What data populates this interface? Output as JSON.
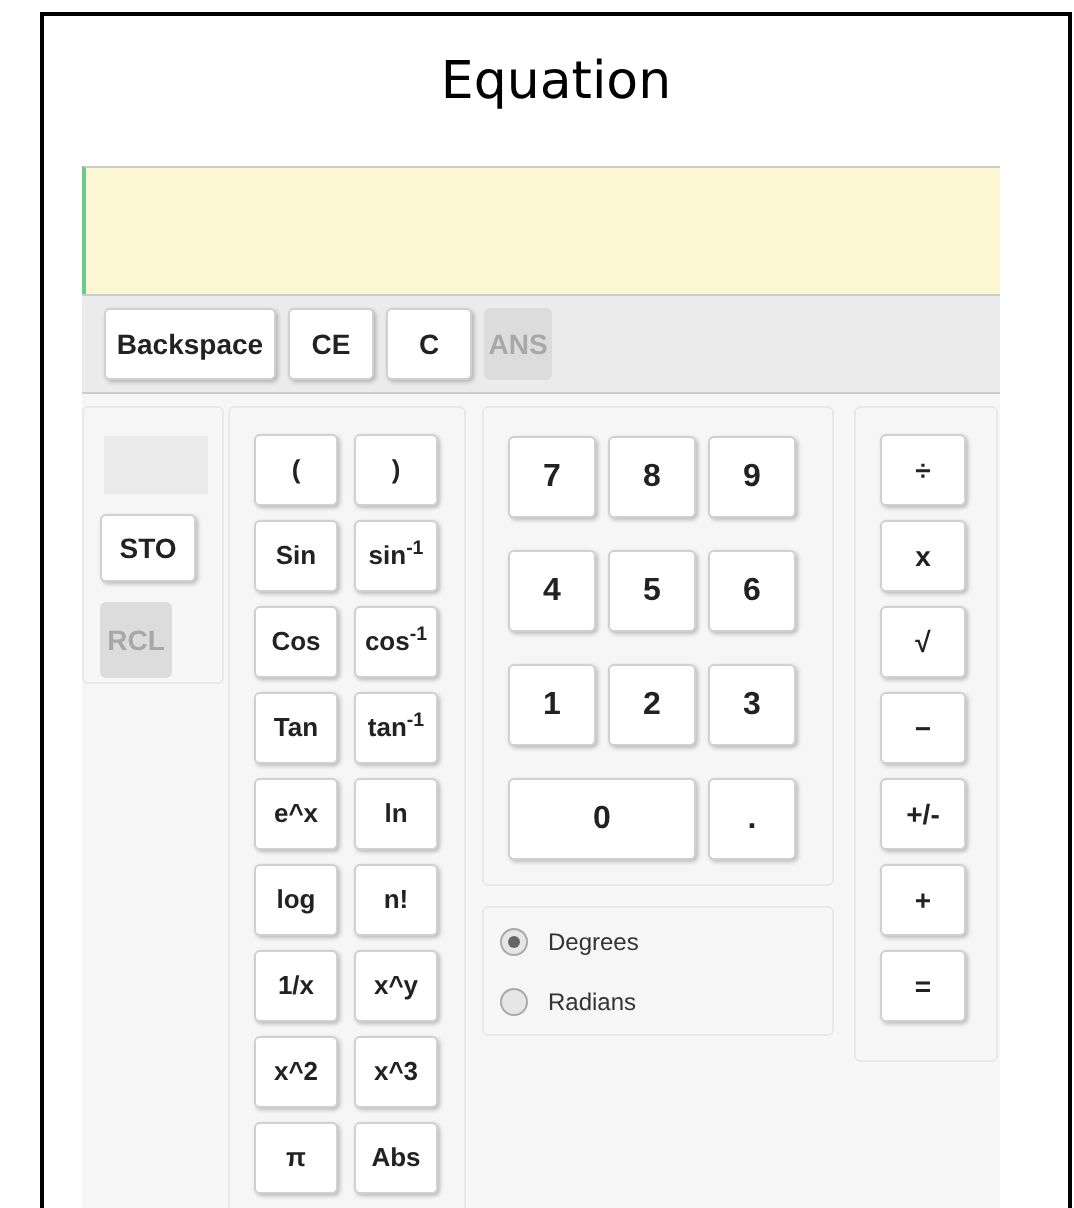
{
  "title": "Equation",
  "toolbar": [
    {
      "label": "Backspace",
      "disabled": false
    },
    {
      "label": "CE",
      "disabled": false
    },
    {
      "label": "C",
      "disabled": false
    },
    {
      "label": "ANS",
      "disabled": true
    }
  ],
  "memory": {
    "buttons": [
      {
        "label": "STO",
        "disabled": false
      },
      {
        "label": "RCL",
        "disabled": true
      }
    ]
  },
  "functions": [
    {
      "label": "("
    },
    {
      "label": ")"
    },
    {
      "label": "Sin"
    },
    {
      "label": "sin$^{-1}$"
    },
    {
      "label": "Cos"
    },
    {
      "label": "cos$^{-1}$"
    },
    {
      "label": "Tan"
    },
    {
      "label": "tan$^{-1}$"
    },
    {
      "label": "e^x"
    },
    {
      "label": "ln"
    },
    {
      "label": "log"
    },
    {
      "label": "n!"
    },
    {
      "label": "1/x"
    },
    {
      "label": "x^y"
    },
    {
      "label": "x^2"
    },
    {
      "label": "x^3"
    },
    {
      "label": "π"
    },
    {
      "label": "Abs"
    }
  ],
  "digits": [
    {
      "label": "7"
    },
    {
      "label": "8"
    },
    {
      "label": "9"
    },
    {
      "label": "4"
    },
    {
      "label": "5"
    },
    {
      "label": "6"
    },
    {
      "label": "1"
    },
    {
      "label": "2"
    },
    {
      "label": "3"
    },
    {
      "label": "0",
      "kind": "wide"
    },
    {
      "label": ".",
      "kind": "normal"
    }
  ],
  "angle": [
    {
      "label": "Degrees",
      "selected": true
    },
    {
      "label": "Radians",
      "selected": false
    }
  ],
  "operators": [
    {
      "label": "÷"
    },
    {
      "label": "x"
    },
    {
      "label": "√"
    },
    {
      "label": "−"
    },
    {
      "label": "+/-"
    },
    {
      "label": "+"
    },
    {
      "label": "="
    }
  ]
}
